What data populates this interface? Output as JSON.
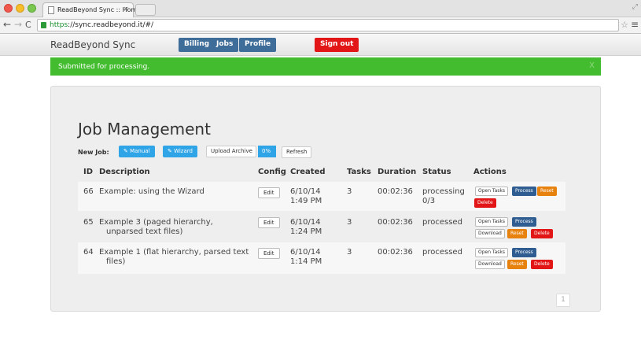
{
  "browser": {
    "tab_title": "ReadBeyond Sync :: Home",
    "tab_close": "×",
    "url_https": "https",
    "url_rest": "://sync.readbeyond.it/#/",
    "nav_back": "←",
    "nav_forward": "→",
    "nav_reload": "C",
    "star": "☆",
    "menu": "≡",
    "resize": "⤢"
  },
  "navbar": {
    "brand": "ReadBeyond Sync",
    "billing": "Billing",
    "jobs": "Jobs",
    "profile": "Profile",
    "sign_out": "Sign out"
  },
  "alert": {
    "message": "Submitted for processing.",
    "close": "X"
  },
  "main": {
    "title": "Job Management",
    "new_job_label": "New Job:",
    "manual_label": "✎ Manual",
    "wizard_label": "✎ Wizard",
    "upload_label": "Upload Archive",
    "upload_progress": "0%",
    "refresh_label": "Refresh"
  },
  "table": {
    "headers": {
      "id": "ID",
      "description": "Description",
      "config": "Config",
      "created": "Created",
      "tasks": "Tasks",
      "duration": "Duration",
      "status": "Status",
      "actions": "Actions"
    },
    "rows": [
      {
        "id": "66",
        "desc1": "Example: using the Wizard",
        "desc2": "",
        "config": "Edit",
        "date": "6/10/14",
        "time": "1:49 PM",
        "tasks": "3",
        "duration": "00:02:36",
        "status1": "processing",
        "status2": "0/3",
        "open_tasks": "Open Tasks",
        "process": "Process",
        "reset": "Reset",
        "delete": "Delete"
      },
      {
        "id": "65",
        "desc1": "Example 3 (paged hierarchy,",
        "desc2": "unparsed text files)",
        "config": "Edit",
        "date": "6/10/14",
        "time": "1:24 PM",
        "tasks": "3",
        "duration": "00:02:36",
        "status1": "processed",
        "status2": "",
        "open_tasks": "Open Tasks",
        "process": "Process",
        "download": "Download",
        "reset": "Reset",
        "delete": "Delete"
      },
      {
        "id": "64",
        "desc1": "Example 1 (flat hierarchy, parsed text",
        "desc2": "files)",
        "config": "Edit",
        "date": "6/10/14",
        "time": "1:14 PM",
        "tasks": "3",
        "duration": "00:02:36",
        "status1": "processed",
        "status2": "",
        "open_tasks": "Open Tasks",
        "process": "Process",
        "download": "Download",
        "reset": "Reset",
        "delete": "Delete"
      }
    ]
  },
  "pagination": {
    "page": "1"
  }
}
